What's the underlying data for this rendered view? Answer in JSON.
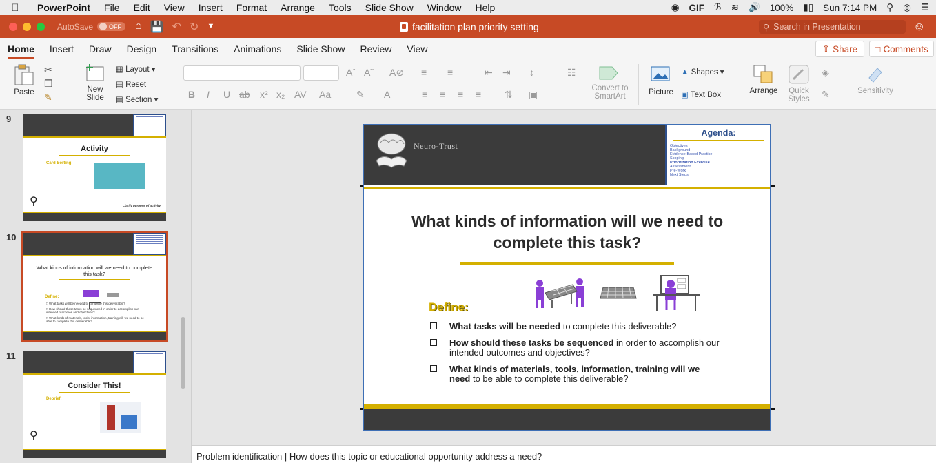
{
  "menubar": {
    "app": "PowerPoint",
    "items": [
      "File",
      "Edit",
      "View",
      "Insert",
      "Format",
      "Arrange",
      "Tools",
      "Slide Show",
      "Window",
      "Help"
    ],
    "battery": "100%",
    "clock": "Sun 7:14 PM"
  },
  "titlebar": {
    "autosave_label": "AutoSave",
    "autosave_state": "OFF",
    "document_title": "facilitation plan priority setting",
    "search_placeholder": "Search in Presentation"
  },
  "ribbon_tabs": [
    "Home",
    "Insert",
    "Draw",
    "Design",
    "Transitions",
    "Animations",
    "Slide Show",
    "Review",
    "View"
  ],
  "share_label": "Share",
  "comments_label": "Comments",
  "ribbon": {
    "paste": "Paste",
    "new_slide_line1": "New",
    "new_slide_line2": "Slide",
    "layout": "Layout",
    "reset": "Reset",
    "section": "Section",
    "convert_line1": "Convert to",
    "convert_line2": "SmartArt",
    "picture": "Picture",
    "shapes": "Shapes",
    "text_box": "Text Box",
    "arrange": "Arrange",
    "quick_line1": "Quick",
    "quick_line2": "Styles",
    "sensitivity": "Sensitivity"
  },
  "thumbnails": [
    {
      "number": "9",
      "title": "Activity",
      "subtitle": "Card Sorting:",
      "caption": "Clarify purpose of activity"
    },
    {
      "number": "10",
      "title": "What kinds of information will we need to complete this task?",
      "subtitle": "Define:"
    },
    {
      "number": "11",
      "title": "Consider This!",
      "subtitle": "Debrief:"
    }
  ],
  "slide": {
    "brand": "Neuro-Trust",
    "agenda_title": "Agenda:",
    "agenda_items": [
      "Objectives",
      "Background",
      "Evidence-Based Practice",
      "Scoping",
      "Prioritization Exercise",
      "Assessment",
      "Pre-Work",
      "Next Steps"
    ],
    "title": "What kinds of information will we need to complete this task?",
    "define": "Define:",
    "bullets": [
      {
        "bold": "What tasks will be needed",
        "rest": " to complete this deliverable?"
      },
      {
        "bold": "How should these tasks be sequenced",
        "rest": " in order to accomplish our intended outcomes and objectives?"
      },
      {
        "bold": "What kinds of materials, tools, information, training will we need",
        "rest": " to be able to complete this deliverable?"
      }
    ]
  },
  "notes": "Problem identification | How does this topic or educational opportunity address a need?",
  "colors": {
    "accent": "#c74a25",
    "gold": "#d4b000",
    "dark": "#3b3b3b",
    "purple": "#8a3fd6"
  }
}
